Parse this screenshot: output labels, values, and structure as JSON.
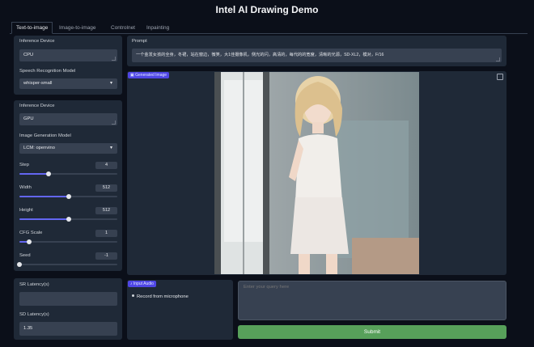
{
  "app": {
    "title": "Intel AI Drawing Demo"
  },
  "tabs": [
    "Text-to-image",
    "Image-to-image",
    "Controlnet",
    "Inpainting"
  ],
  "speech_panel": {
    "device_label": "Inference Device",
    "device_value": "CPU",
    "model_label": "Speech Recognition Model",
    "model_value": "whisper-small"
  },
  "gen_panel": {
    "device_label": "Inference Device",
    "device_value": "GPU",
    "model_label": "Image Generation Model",
    "model_value": "LCM: openvino",
    "step": {
      "label": "Step",
      "value": "4",
      "fraction": 0.3
    },
    "width": {
      "label": "Width",
      "value": "512",
      "fraction": 0.5
    },
    "height": {
      "label": "Height",
      "value": "512",
      "fraction": 0.5
    },
    "cfg": {
      "label": "CFG Scale",
      "value": "1",
      "fraction": 0.1
    },
    "seed": {
      "label": "Seed",
      "value": "-1",
      "fraction": 0.0
    }
  },
  "prompt": {
    "label": "Prompt",
    "value": "一个金发女孩的全身，冬裙，站在窗边，微笑，大1佳摄像机，侧光的闪，高清的，每代的的宽度，清晰的光源，SD-XL2，模对，F/16"
  },
  "output": {
    "badge": "Generated Image"
  },
  "latency": {
    "sr_label": "SR Latency(s)",
    "sr_value": "",
    "sd_label": "SD Latency(s)",
    "sd_value": "1.35"
  },
  "audio": {
    "badge": "Input Audio",
    "record_label": "Record from microphone"
  },
  "query": {
    "placeholder": "Enter your query here"
  },
  "submit": {
    "label": "Submit"
  },
  "colors": {
    "accent": "#6366f1",
    "submit": "#57a05a",
    "panel": "#1f2937",
    "background": "#0b0f19"
  }
}
